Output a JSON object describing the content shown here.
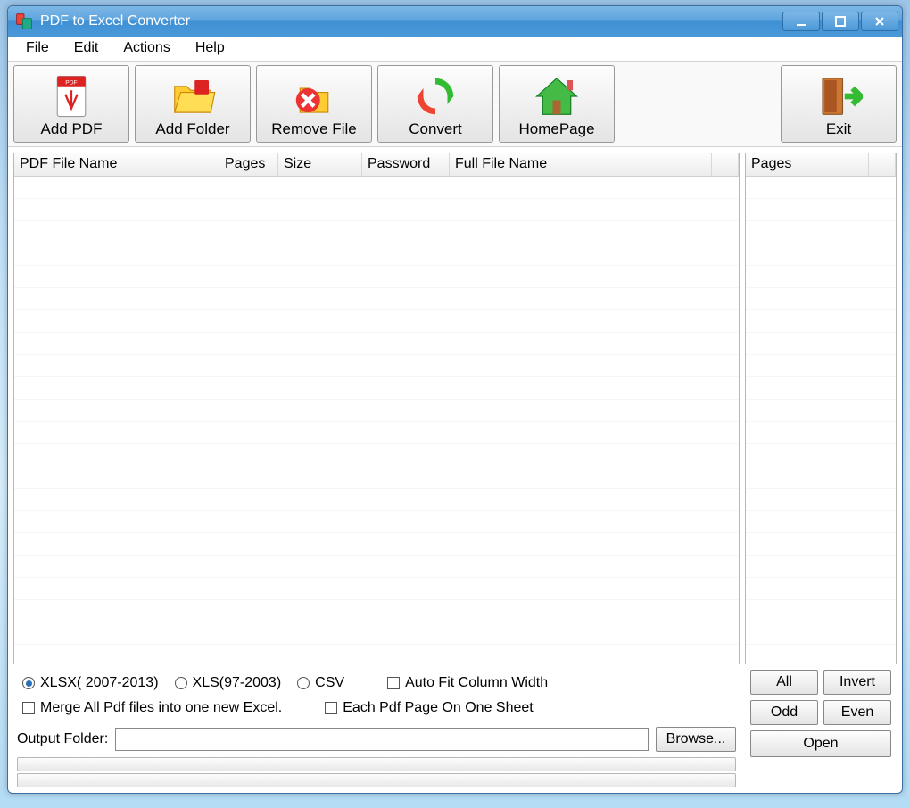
{
  "title": "PDF to Excel Converter",
  "menu": {
    "file": "File",
    "edit": "Edit",
    "actions": "Actions",
    "help": "Help"
  },
  "toolbar": {
    "add_pdf": "Add PDF",
    "add_folder": "Add Folder",
    "remove_file": "Remove File",
    "convert": "Convert",
    "homepage": "HomePage",
    "exit": "Exit"
  },
  "columns": {
    "file_name": "PDF File Name",
    "pages": "Pages",
    "size": "Size",
    "password": "Password",
    "full_name": "Full File Name"
  },
  "side_column": "Pages",
  "formats": {
    "xlsx": "XLSX( 2007-2013)",
    "xls": "XLS(97-2003)",
    "csv": "CSV",
    "selected": "xlsx"
  },
  "checks": {
    "autofit": "Auto Fit Column Width",
    "merge": "Merge All Pdf files into one new Excel.",
    "each_page": "Each Pdf Page On One Sheet"
  },
  "sidebuttons": {
    "all": "All",
    "invert": "Invert",
    "odd": "Odd",
    "even": "Even",
    "open": "Open"
  },
  "output": {
    "label": "Output Folder:",
    "value": "",
    "browse": "Browse..."
  }
}
